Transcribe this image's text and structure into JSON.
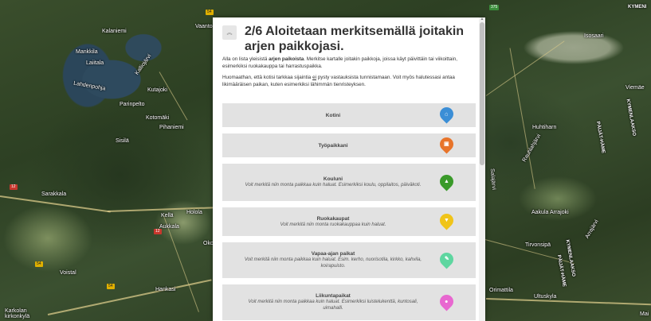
{
  "map": {
    "labels": [
      {
        "text": "Kalaniemi",
        "cls": ""
      },
      {
        "text": "Mankkila",
        "cls": ""
      },
      {
        "text": "Laiitala",
        "cls": ""
      },
      {
        "text": "Lahdenpohja",
        "cls": ""
      },
      {
        "text": "Kalliojärvi",
        "cls": ""
      },
      {
        "text": "Kutajoki",
        "cls": ""
      },
      {
        "text": "Parinpelto",
        "cls": ""
      },
      {
        "text": "Kotomäki",
        "cls": ""
      },
      {
        "text": "Pihaniemi",
        "cls": ""
      },
      {
        "text": "Sisilä",
        "cls": ""
      },
      {
        "text": "Sarakkala",
        "cls": ""
      },
      {
        "text": "Kellä",
        "cls": ""
      },
      {
        "text": "Aukkala",
        "cls": ""
      },
      {
        "text": "Holola",
        "cls": ""
      },
      {
        "text": "Voistal",
        "cls": ""
      },
      {
        "text": "Hankasi",
        "cls": ""
      },
      {
        "text": "Karkolan kirkonkylä",
        "cls": ""
      },
      {
        "text": "Vaanto",
        "cls": ""
      },
      {
        "text": "Isosaari",
        "cls": ""
      },
      {
        "text": "Viemäe",
        "cls": ""
      },
      {
        "text": "KYMENLAAKSO",
        "cls": "bold"
      },
      {
        "text": "PÄIJÄT-HÄME",
        "cls": "bold"
      },
      {
        "text": "Huhtiharn",
        "cls": ""
      },
      {
        "text": "Rauhlahjärvi",
        "cls": ""
      },
      {
        "text": "Salajärvi",
        "cls": ""
      },
      {
        "text": "Aakula Arrajoki",
        "cls": ""
      },
      {
        "text": "Tirvonsipä",
        "cls": ""
      },
      {
        "text": "Arrajärvi",
        "cls": ""
      },
      {
        "text": "KYMENLAAKSO",
        "cls": "bold"
      },
      {
        "text": "PÄIJÄT-HÄME",
        "cls": "bold"
      },
      {
        "text": "Ultuskyla",
        "cls": ""
      },
      {
        "text": "Orimattila",
        "cls": ""
      },
      {
        "text": "KYMENI",
        "cls": "bold"
      },
      {
        "text": "Okc",
        "cls": ""
      },
      {
        "text": "Mai",
        "cls": ""
      }
    ],
    "shields": [
      "12",
      "12",
      "54",
      "54",
      "54",
      "375"
    ]
  },
  "panel": {
    "collapse_icon": "chevron-up",
    "title": "2/6 Aloitetaan merkitsemällä joitakin arjen paikkojasi.",
    "intro_1a": "Alla on lista yleisistä ",
    "intro_1b": "arjen paikoista",
    "intro_1c": ". Merkitse kartalle joitakin paikkoja, joissa käyt päivittäin tai viikoittain, esimerkiksi ruokakauppa tai harrastuspaikka.",
    "intro_2a": "Huomaathan, että kotisi tarkkaa sijaintia ",
    "intro_2b": "ei",
    "intro_2c": " pysty vastauksista tunnistamaan. Voit myös halutessasi antaa likimääräisen paikan, kuten esimerkiksi lähimmän tienristeyksen.",
    "items": [
      {
        "label": "Kotini",
        "hint": "",
        "color": "#3b8ed6",
        "icon": "home-icon",
        "glyph": "⌂"
      },
      {
        "label": "Työpaikkani",
        "hint": "",
        "color": "#e8742a",
        "icon": "briefcase-icon",
        "glyph": "▣"
      },
      {
        "label": "Kouluni",
        "hint": "Voit merkitä niin monta paikkaa kuin haluat. Esimerkiksi koulu, oppilaitos, päiväkoti.",
        "color": "#3a9a2a",
        "icon": "graduation-cap-icon",
        "glyph": "▲"
      },
      {
        "label": "Ruokakaupat",
        "hint": "Voit merkitä niin monta ruokakauppaa kuin haluat.",
        "color": "#f0c419",
        "icon": "shopping-cart-icon",
        "glyph": "▼"
      },
      {
        "label": "Vapaa-ajan paikat",
        "hint": "Voit merkitä niin monta paikkaa kuin haluat. Esim. kerho, nuorisotila, kirkko, kahvila, koirapuisto.",
        "color": "#5ed6a0",
        "icon": "pencil-icon",
        "glyph": "✎"
      },
      {
        "label": "Liikuntapaikat",
        "hint": "Voit merkitä niin monta paikkaa kuin haluat. Esimerkiksi luistelukenttä, kuntosali, uimahalli.",
        "color": "#e868d0",
        "icon": "runner-icon",
        "glyph": "●"
      }
    ]
  }
}
